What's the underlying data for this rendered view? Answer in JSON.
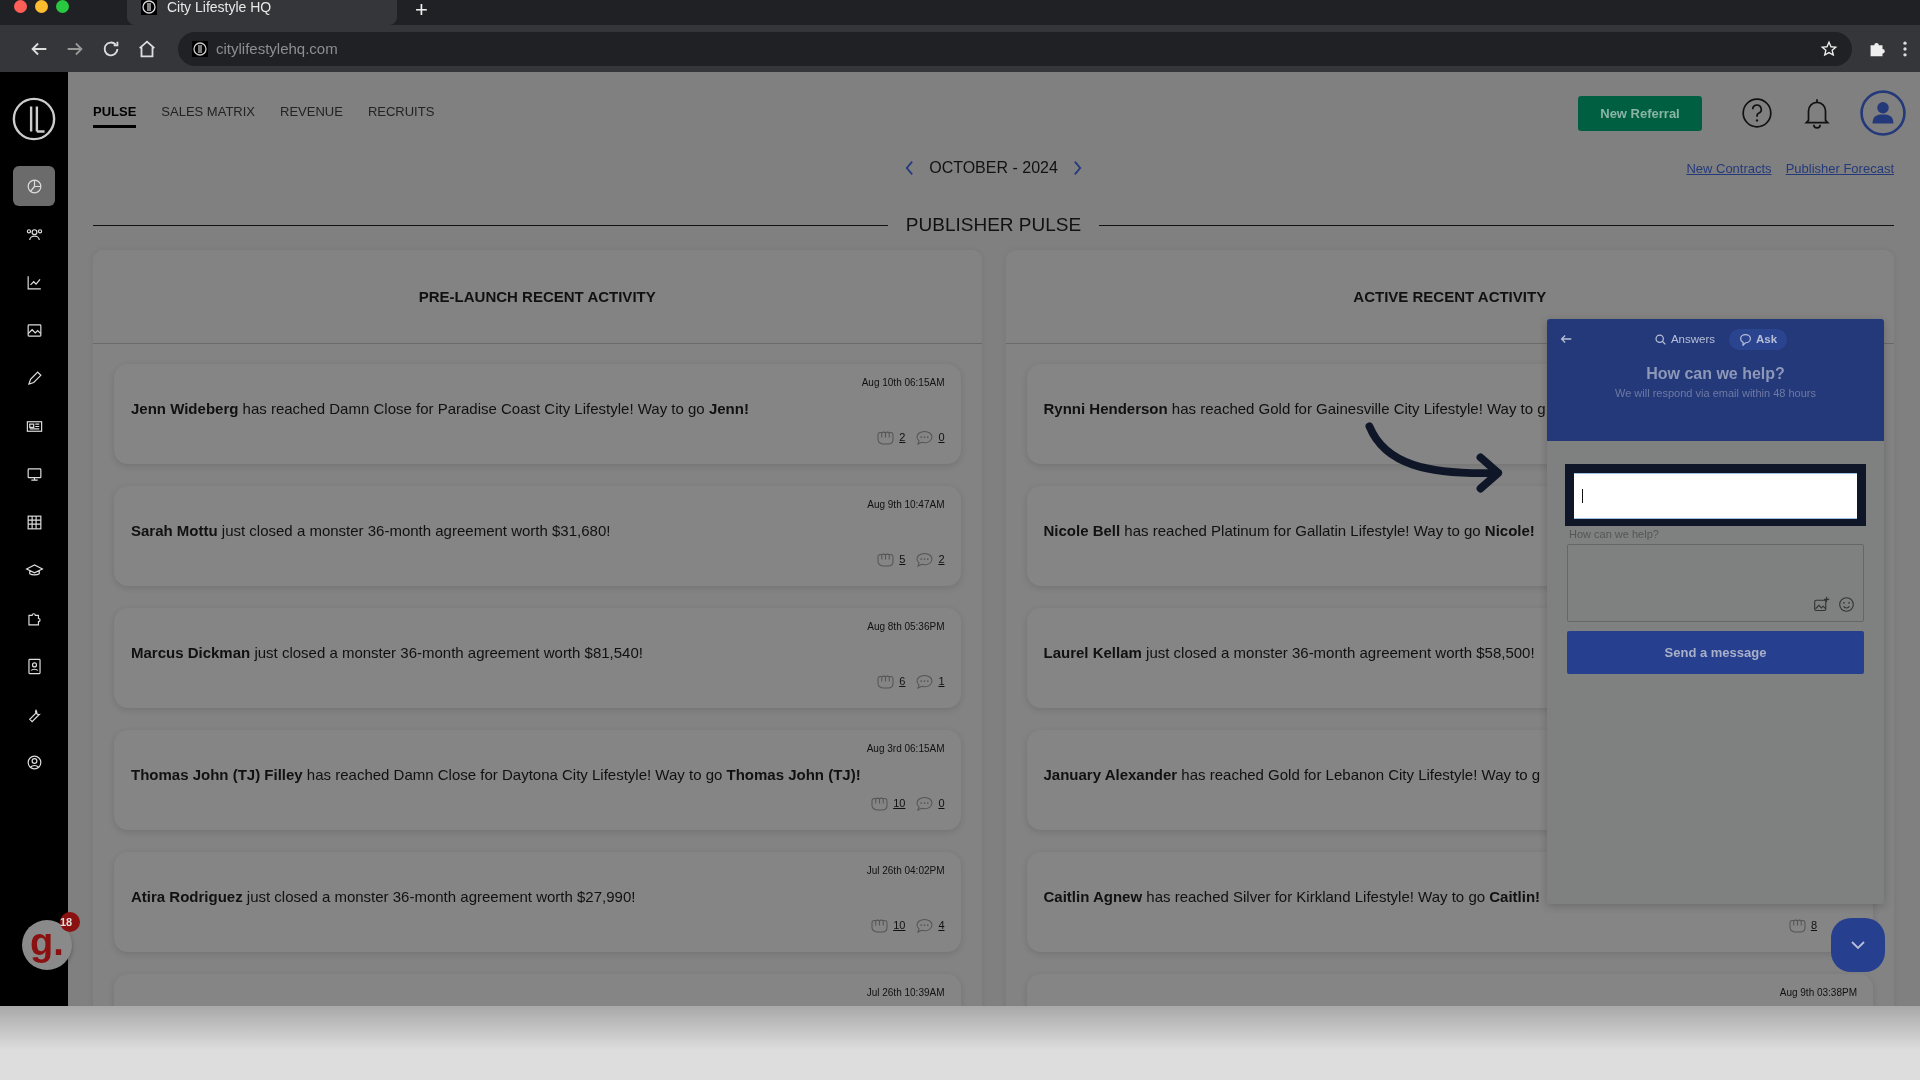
{
  "browser": {
    "tab_title": "City Lifestyle HQ",
    "new_tab": "+",
    "url": "citylifestylehq.com"
  },
  "sidebar": {
    "items": [
      {
        "selected": true
      },
      {
        "selected": false
      },
      {
        "selected": false
      },
      {
        "selected": false
      },
      {
        "selected": false
      },
      {
        "selected": false
      },
      {
        "selected": false
      },
      {
        "selected": false
      },
      {
        "selected": false
      },
      {
        "selected": false
      },
      {
        "selected": false
      },
      {
        "selected": false
      },
      {
        "selected": false
      }
    ]
  },
  "nav_tabs": [
    {
      "label": "PULSE",
      "selected": true
    },
    {
      "label": "SALES MATRIX",
      "selected": false
    },
    {
      "label": "REVENUE",
      "selected": false
    },
    {
      "label": "RECRUITS",
      "selected": false
    }
  ],
  "header": {
    "new_referral": "New Referral"
  },
  "month": "OCTOBER - 2024",
  "links": [
    "New Contracts",
    "Publisher Forecast"
  ],
  "section_title": "PUBLISHER PULSE",
  "panels": [
    {
      "title": "PRE-LAUNCH RECENT ACTIVITY",
      "items": [
        {
          "time": "Aug 10th 06:15AM",
          "text": "**Jenn Wideberg** has reached Damn Close for Paradise Coast City Lifestyle! Way to go **Jenn!**",
          "fists": "2",
          "comments": "0"
        },
        {
          "time": "Aug 9th 10:47AM",
          "text": "**Sarah Mottu** just closed a monster 36-month agreement worth $31,680!",
          "fists": "5",
          "comments": "2"
        },
        {
          "time": "Aug 8th 05:36PM",
          "text": "**Marcus Dickman** just closed a monster 36-month agreement worth $81,540!",
          "fists": "6",
          "comments": "1"
        },
        {
          "time": "Aug 3rd 06:15AM",
          "text": "**Thomas John (TJ) Filley** has reached Damn Close for Daytona City Lifestyle! Way to go **Thomas John (TJ)!**",
          "fists": "10",
          "comments": "0"
        },
        {
          "time": "Jul 26th 04:02PM",
          "text": "**Atira Rodriguez** just closed a monster 36-month agreement worth $27,990!",
          "fists": "10",
          "comments": "4"
        },
        {
          "time": "Jul 26th 10:39AM"
        }
      ]
    },
    {
      "title": "ACTIVE RECENT ACTIVITY",
      "items": [
        {
          "text": "**Rynni Henderson** has reached Gold for Gainesville City Lifestyle! Way to g"
        },
        {
          "text": "**Nicole Bell** has reached Platinum for Gallatin Lifestyle! Way to go **Nicole!**"
        },
        {
          "text": "**Laurel Kellam** just closed a monster 36-month agreement worth $58,500!"
        },
        {
          "text": "**January Alexander** has reached Gold for Lebanon City Lifestyle! Way to g"
        },
        {
          "text": "**Caitlin Agnew** has reached Silver for Kirkland Lifestyle! Way to go **Caitlin!**",
          "fists": "8"
        },
        {
          "time": "Aug 9th 03:38PM"
        }
      ]
    }
  ],
  "help_widget": {
    "tabs": [
      {
        "label": "Answers",
        "selected": false
      },
      {
        "label": "Ask",
        "selected": true
      }
    ],
    "title": "How can we help?",
    "subtitle": "We will respond via email within 48 hours",
    "field_label": "How can we help?",
    "send": "Send a message"
  },
  "launcher": {
    "letter": "g.",
    "badge": "18"
  }
}
